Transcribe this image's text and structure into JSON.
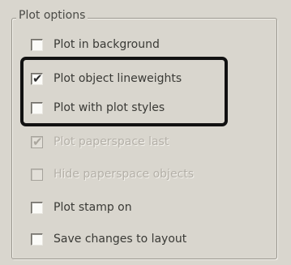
{
  "group": {
    "title": "Plot options"
  },
  "options": [
    {
      "label": "Plot in background",
      "checked": false,
      "enabled": true
    },
    {
      "label": "Plot object lineweights",
      "checked": true,
      "enabled": true
    },
    {
      "label": "Plot with plot styles",
      "checked": false,
      "enabled": true
    },
    {
      "label": "Plot paperspace last",
      "checked": true,
      "enabled": false
    },
    {
      "label": "Hide paperspace objects",
      "checked": false,
      "enabled": false
    },
    {
      "label": "Plot stamp on",
      "checked": false,
      "enabled": true
    },
    {
      "label": "Save changes to layout",
      "checked": false,
      "enabled": true
    }
  ],
  "check_glyph": "✔"
}
